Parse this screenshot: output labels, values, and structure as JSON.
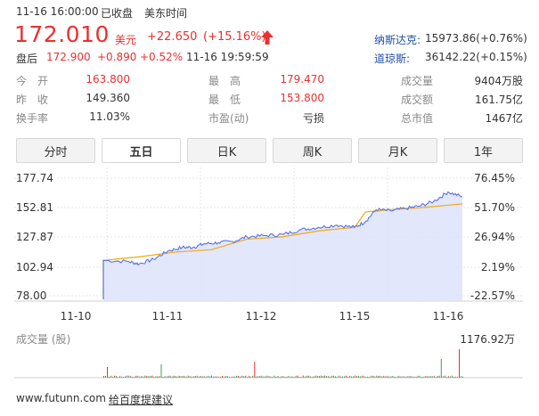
{
  "header": {
    "datetime": "11-16 16:00:00",
    "status": "已收盘",
    "timezone": "美东时间"
  },
  "quote": {
    "price": "172.010",
    "currency": "美元",
    "change": "+22.650",
    "change_pct": "(+15.16%)",
    "up_arrow_icon": "arrow-up-icon"
  },
  "after_hours": {
    "label": "盘后",
    "price": "172.900",
    "change": "+0.890",
    "change_pct": "+0.52%",
    "time": "11-16 19:59:59"
  },
  "indices": [
    {
      "name": "纳斯达克:",
      "value": "15973.86(+0.76%)"
    },
    {
      "name": "道琼斯:",
      "value": "36142.22(+0.15%)"
    }
  ],
  "stats": {
    "open": {
      "label": "今　开",
      "value": "163.800"
    },
    "prev_close": {
      "label": "昨　收",
      "value": "149.360"
    },
    "turnover_rate": {
      "label": "换手率",
      "value": "11.03%"
    },
    "high": {
      "label": "最　高",
      "value": "179.470"
    },
    "low": {
      "label": "最　低",
      "value": "153.800"
    },
    "pe": {
      "label": "市盈(动)",
      "value": "亏损"
    },
    "volume": {
      "label": "成交量",
      "value": "9404万股"
    },
    "amount": {
      "label": "成交额",
      "value": "161.75亿"
    },
    "market_cap": {
      "label": "总市值",
      "value": "1467亿"
    }
  },
  "tabs": [
    "分时",
    "五日",
    "日K",
    "周K",
    "月K",
    "1年"
  ],
  "active_tab": "五日",
  "chart_labels": {
    "y_left": [
      "177.74",
      "152.81",
      "127.87",
      "102.94",
      "78.00"
    ],
    "y_right": [
      "76.45%",
      "51.70%",
      "26.94%",
      "2.19%",
      "-22.57%"
    ],
    "x": [
      "11-10",
      "11-11",
      "11-12",
      "11-15",
      "11-16"
    ],
    "volume_title": "成交量 (股)",
    "volume_max": "1176.92万"
  },
  "footer": {
    "site": "www.futunn.com",
    "feedback": "给百度提建议"
  },
  "colors": {
    "up": "#e93030",
    "price_line": "#5a73e0",
    "avg_line": "#f0b020",
    "fill": "#dde3fb"
  },
  "chart_data": {
    "type": "line",
    "title": "",
    "xlabel": "",
    "ylabel": "",
    "categories": [
      "11-10",
      "11-11",
      "11-12",
      "11-15",
      "11-16"
    ],
    "ylim": [
      78.0,
      177.74
    ],
    "series": [
      {
        "name": "price",
        "x": [
          0.0,
          0.07,
          0.1,
          0.14,
          0.18,
          0.22,
          0.25,
          0.28,
          0.32,
          0.36,
          0.4,
          0.45,
          0.5,
          0.55,
          0.6,
          0.65,
          0.7,
          0.73,
          0.76,
          0.8,
          0.84,
          0.88,
          0.92,
          0.96,
          1.0
        ],
        "values": [
          108,
          107,
          105,
          109,
          116,
          119,
          119,
          122,
          123,
          124,
          128,
          129,
          130,
          134,
          136,
          138,
          136,
          141,
          151,
          150,
          152,
          154,
          158,
          166,
          162
        ]
      },
      {
        "name": "avg",
        "x": [
          0.0,
          0.1,
          0.2,
          0.3,
          0.4,
          0.5,
          0.6,
          0.7,
          0.73,
          0.8,
          0.9,
          1.0
        ],
        "values": [
          108,
          111,
          115,
          117,
          126,
          128,
          133,
          136,
          149,
          151,
          153,
          156
        ]
      }
    ],
    "volume": {
      "max": "1176.92万",
      "spikes": [
        0.01,
        0.16,
        0.42,
        0.94,
        0.99
      ]
    }
  }
}
